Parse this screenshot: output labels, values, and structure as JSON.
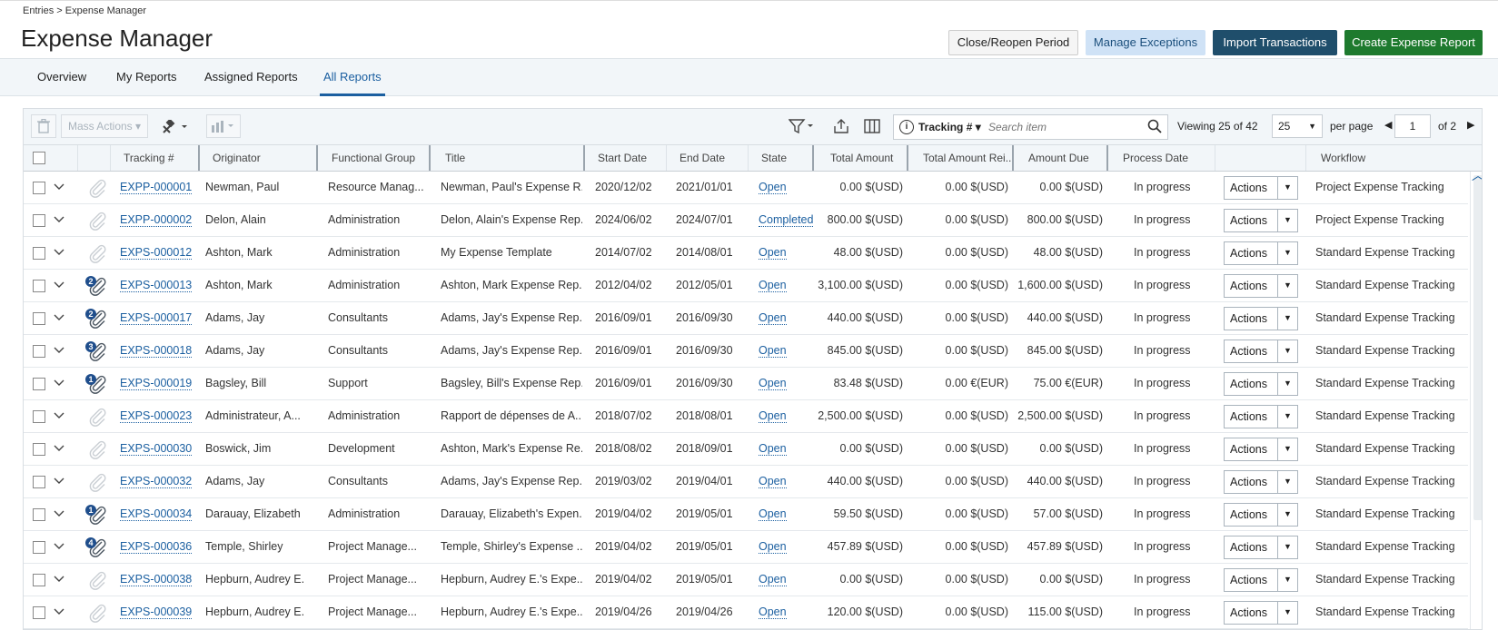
{
  "breadcrumb": "Entries > Expense Manager",
  "title": "Expense Manager",
  "header_buttons": {
    "close_reopen": "Close/Reopen Period",
    "manage_exceptions": "Manage Exceptions",
    "import_transactions": "Import Transactions",
    "create_report": "Create Expense Report"
  },
  "tabs": [
    {
      "label": "Overview"
    },
    {
      "label": "My Reports"
    },
    {
      "label": "Assigned Reports"
    },
    {
      "label": "All Reports"
    }
  ],
  "toolbar": {
    "mass_actions": "Mass Actions ▾",
    "search_field": "Tracking # ▾",
    "search_placeholder": "Search item",
    "viewing_prefix": "Viewing",
    "viewing_count": "25",
    "viewing_of": "of",
    "viewing_total": "42",
    "per_page_value": "25",
    "per_page_label": "per page",
    "page_current": "1",
    "page_of": "of 2"
  },
  "columns": [
    "Tracking #",
    "Originator",
    "Functional Group",
    "Title",
    "Start Date",
    "End Date",
    "State",
    "Total Amount",
    "Total Amount Rei...",
    "Amount Due",
    "Process Date",
    "Workflow"
  ],
  "actions_label": "Actions",
  "rows": [
    {
      "tracking": "EXPP-000001",
      "originator": "Newman, Paul",
      "group": "Resource Manag...",
      "title": "Newman, Paul's Expense R...",
      "start": "2020/12/02",
      "end": "2021/01/01",
      "state": "Open",
      "total": "0.00 $(USD)",
      "reimb": "0.00 $(USD)",
      "due": "0.00 $(USD)",
      "process": "In progress",
      "workflow": "Project Expense Tracking",
      "badge": ""
    },
    {
      "tracking": "EXPP-000002",
      "originator": "Delon, Alain",
      "group": "Administration",
      "title": "Delon, Alain's Expense Rep...",
      "start": "2024/06/02",
      "end": "2024/07/01",
      "state": "Completed",
      "total": "800.00 $(USD)",
      "reimb": "0.00 $(USD)",
      "due": "800.00 $(USD)",
      "process": "In progress",
      "workflow": "Project Expense Tracking",
      "badge": ""
    },
    {
      "tracking": "EXPS-000012",
      "originator": "Ashton, Mark",
      "group": "Administration",
      "title": "My Expense Template",
      "start": "2014/07/02",
      "end": "2014/08/01",
      "state": "Open",
      "total": "48.00 $(USD)",
      "reimb": "0.00 $(USD)",
      "due": "48.00 $(USD)",
      "process": "In progress",
      "workflow": "Standard Expense Tracking",
      "badge": ""
    },
    {
      "tracking": "EXPS-000013",
      "originator": "Ashton, Mark",
      "group": "Administration",
      "title": "Ashton, Mark Expense Rep...",
      "start": "2012/04/02",
      "end": "2012/05/01",
      "state": "Open",
      "total": "3,100.00 $(USD)",
      "reimb": "0.00 $(USD)",
      "due": "1,600.00 $(USD)",
      "process": "In progress",
      "workflow": "Standard Expense Tracking",
      "badge": "2"
    },
    {
      "tracking": "EXPS-000017",
      "originator": "Adams, Jay",
      "group": "Consultants",
      "title": "Adams, Jay's Expense Rep...",
      "start": "2016/09/01",
      "end": "2016/09/30",
      "state": "Open",
      "total": "440.00 $(USD)",
      "reimb": "0.00 $(USD)",
      "due": "440.00 $(USD)",
      "process": "In progress",
      "workflow": "Standard Expense Tracking",
      "badge": "2"
    },
    {
      "tracking": "EXPS-000018",
      "originator": "Adams, Jay",
      "group": "Consultants",
      "title": "Adams, Jay's Expense Rep...",
      "start": "2016/09/01",
      "end": "2016/09/30",
      "state": "Open",
      "total": "845.00 $(USD)",
      "reimb": "0.00 $(USD)",
      "due": "845.00 $(USD)",
      "process": "In progress",
      "workflow": "Standard Expense Tracking",
      "badge": "3"
    },
    {
      "tracking": "EXPS-000019",
      "originator": "Bagsley, Bill",
      "group": "Support",
      "title": "Bagsley, Bill's Expense Rep...",
      "start": "2016/09/01",
      "end": "2016/09/30",
      "state": "Open",
      "total": "83.48 $(USD)",
      "reimb": "0.00 €(EUR)",
      "due": "75.00 €(EUR)",
      "process": "In progress",
      "workflow": "Standard Expense Tracking",
      "badge": "1"
    },
    {
      "tracking": "EXPS-000023",
      "originator": "Administrateur, A...",
      "group": "Administration",
      "title": "Rapport de dépenses de A...",
      "start": "2018/07/02",
      "end": "2018/08/01",
      "state": "Open",
      "total": "2,500.00 $(USD)",
      "reimb": "0.00 $(USD)",
      "due": "2,500.00 $(USD)",
      "process": "In progress",
      "workflow": "Standard Expense Tracking",
      "badge": ""
    },
    {
      "tracking": "EXPS-000030",
      "originator": "Boswick, Jim",
      "group": "Development",
      "title": "Ashton, Mark's Expense Re...",
      "start": "2018/08/02",
      "end": "2018/09/01",
      "state": "Open",
      "total": "0.00 $(USD)",
      "reimb": "0.00 $(USD)",
      "due": "0.00 $(USD)",
      "process": "In progress",
      "workflow": "Standard Expense Tracking",
      "badge": ""
    },
    {
      "tracking": "EXPS-000032",
      "originator": "Adams, Jay",
      "group": "Consultants",
      "title": "Adams, Jay's Expense Rep...",
      "start": "2019/03/02",
      "end": "2019/04/01",
      "state": "Open",
      "total": "440.00 $(USD)",
      "reimb": "0.00 $(USD)",
      "due": "440.00 $(USD)",
      "process": "In progress",
      "workflow": "Standard Expense Tracking",
      "badge": ""
    },
    {
      "tracking": "EXPS-000034",
      "originator": "Darauay, Elizabeth",
      "group": "Administration",
      "title": "Darauay, Elizabeth's Expen...",
      "start": "2019/04/02",
      "end": "2019/05/01",
      "state": "Open",
      "total": "59.50 $(USD)",
      "reimb": "0.00 $(USD)",
      "due": "57.00 $(USD)",
      "process": "In progress",
      "workflow": "Standard Expense Tracking",
      "badge": "1"
    },
    {
      "tracking": "EXPS-000036",
      "originator": "Temple, Shirley",
      "group": "Project Manage...",
      "title": "Temple, Shirley's Expense ...",
      "start": "2019/04/02",
      "end": "2019/05/01",
      "state": "Open",
      "total": "457.89 $(USD)",
      "reimb": "0.00 $(USD)",
      "due": "457.89 $(USD)",
      "process": "In progress",
      "workflow": "Standard Expense Tracking",
      "badge": "4"
    },
    {
      "tracking": "EXPS-000038",
      "originator": "Hepburn, Audrey E.",
      "group": "Project Manage...",
      "title": "Hepburn, Audrey E.'s Expe...",
      "start": "2019/04/02",
      "end": "2019/05/01",
      "state": "Open",
      "total": "0.00 $(USD)",
      "reimb": "0.00 $(USD)",
      "due": "0.00 $(USD)",
      "process": "In progress",
      "workflow": "Standard Expense Tracking",
      "badge": ""
    },
    {
      "tracking": "EXPS-000039",
      "originator": "Hepburn, Audrey E.",
      "group": "Project Manage...",
      "title": "Hepburn, Audrey E.'s Expe...",
      "start": "2019/04/26",
      "end": "2019/04/26",
      "state": "Open",
      "total": "120.00 $(USD)",
      "reimb": "0.00 $(USD)",
      "due": "115.00 $(USD)",
      "process": "In progress",
      "workflow": "Standard Expense Tracking",
      "badge": ""
    }
  ]
}
